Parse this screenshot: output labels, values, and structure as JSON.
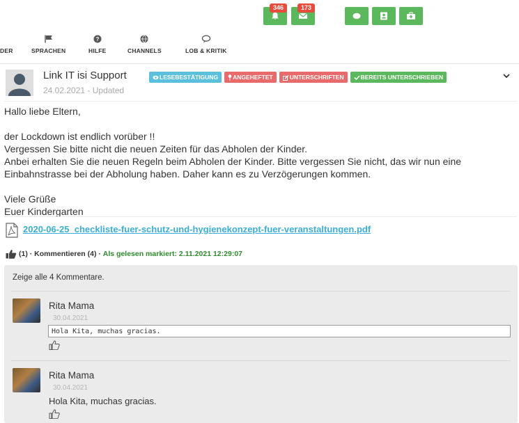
{
  "topbar": {
    "notifications_count": "346",
    "messages_count": "173",
    "accent": "#5cb85c",
    "badge_color": "#e74c3c",
    "buttons": [
      "bell-icon",
      "envelope-icon",
      "chat-bubble-icon",
      "contact-card-icon",
      "medkit-icon"
    ]
  },
  "nav": {
    "items": [
      {
        "label": "DER",
        "icon": ""
      },
      {
        "label": "SPRACHEN",
        "icon": "flag-icon"
      },
      {
        "label": "HILFE",
        "icon": "question-icon"
      },
      {
        "label": "CHANNELS",
        "icon": "globe-icon"
      },
      {
        "label": "LOB & KRITIK",
        "icon": "comment-icon"
      }
    ]
  },
  "post": {
    "author": "Link IT isi Support",
    "date": "24.02.2021 - Updated",
    "labels": [
      {
        "text": "LESEBESTÄTIGUNG",
        "color": "#5bc0de",
        "icon": "eye-icon"
      },
      {
        "text": "ANGEHEFTET",
        "color": "#e96a6a",
        "icon": "pin-icon"
      },
      {
        "text": "UNTERSCHRIFTEN",
        "color": "#e96a6a",
        "icon": "edit-icon"
      },
      {
        "text": "BEREITS UNTERSCHRIEBEN",
        "color": "#5cb85c",
        "icon": "check-icon"
      }
    ],
    "body": [
      "Hallo liebe Eltern,",
      "",
      "der Lockdown ist endlich vorüber !!",
      "Vergessen Sie bitte nicht die neuen Zeiten für das Abholen der Kinder.",
      "Anbei erhalten Sie die neuen Regeln beim Abholen der Kinder. Bitte vergessen Sie nicht, das wir nun eine Einbahnstrasse bei der Abholung haben. Daher kann es zu Verzögerungen kommen.",
      "",
      "Viele Grüße",
      "Euer Kindergarten"
    ],
    "attachment": "2020-06-25_checkliste-fuer-schutz-und-hygienekonzept-fuer-veranstaltungen.pdf",
    "likes": "(1)",
    "comment_action": "· Kommentieren (4) ·",
    "read_status": "Als gelesen markiert: 2.11.2021 12:29:07"
  },
  "comments": {
    "show_all": "Zeige alle 4 Kommentare.",
    "items": [
      {
        "name": "Rita Mama",
        "date": "30.04.2021",
        "text": "Hola Kita, muchas gracias.",
        "editing": true
      },
      {
        "name": "Rita Mama",
        "date": "30.04.2021",
        "text": "Hola Kita, muchas gracias.",
        "editing": false
      }
    ]
  }
}
